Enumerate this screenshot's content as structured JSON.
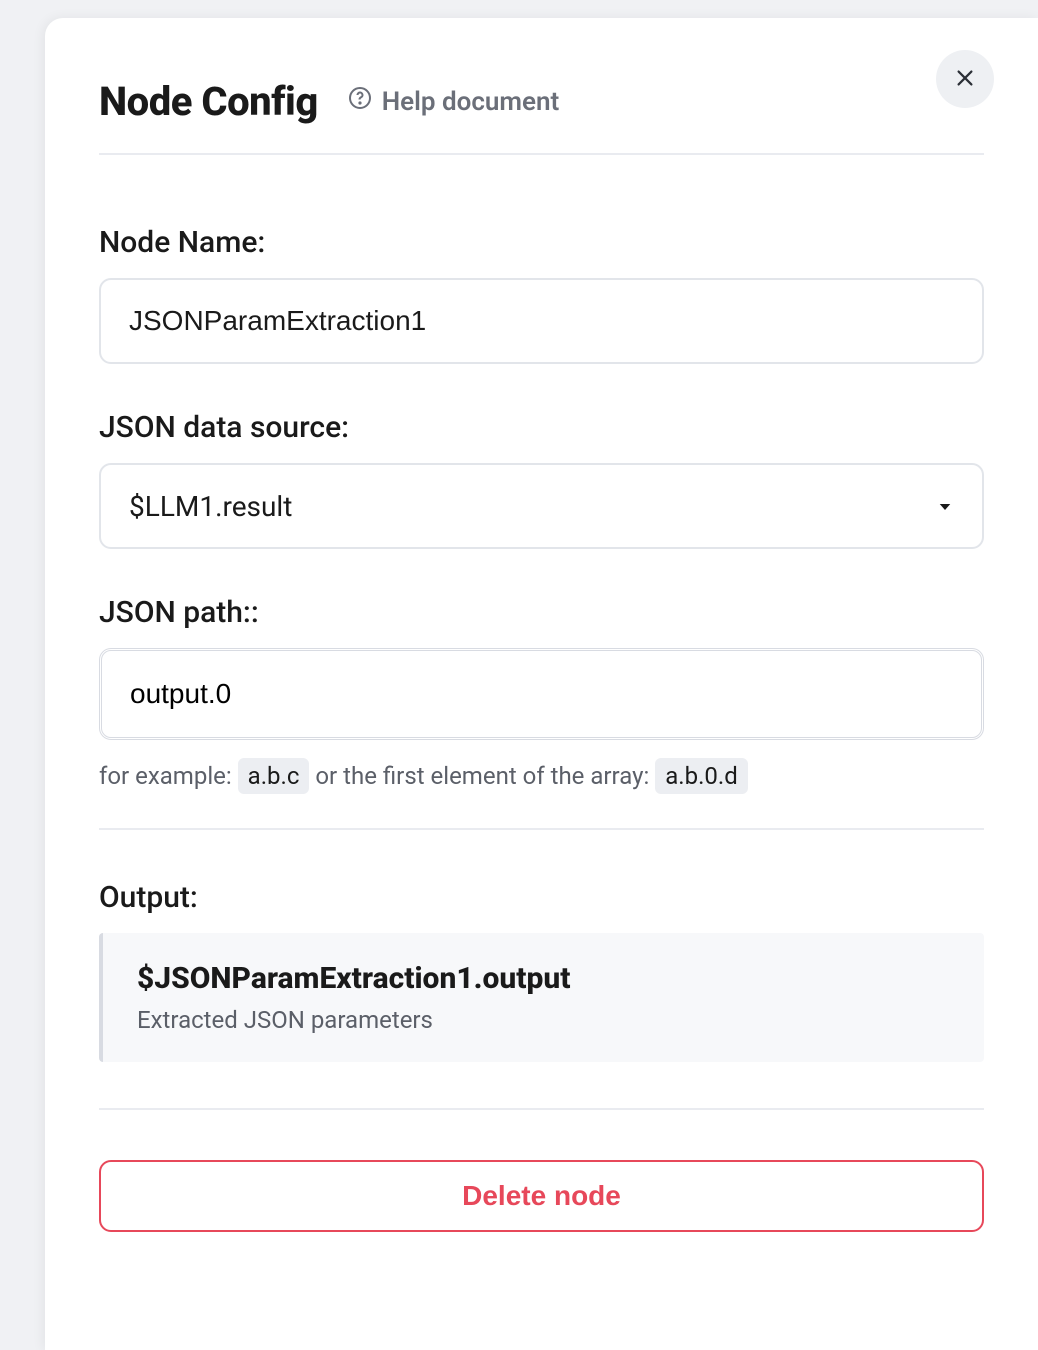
{
  "header": {
    "title": "Node Config",
    "help_label": "Help document"
  },
  "fields": {
    "node_name": {
      "label": "Node Name:",
      "value": "JSONParamExtraction1"
    },
    "json_source": {
      "label": "JSON data source:",
      "value": "$LLM1.result"
    },
    "json_path": {
      "label": "JSON path::",
      "value": "output.0",
      "hint_prefix": "for example:",
      "hint_code1": "a.b.c",
      "hint_mid": "or the first element of the array:",
      "hint_code2": "a.b.0.d"
    }
  },
  "output": {
    "label": "Output:",
    "variable": "$JSONParamExtraction1.output",
    "description": "Extracted JSON parameters"
  },
  "actions": {
    "delete_label": "Delete node"
  }
}
